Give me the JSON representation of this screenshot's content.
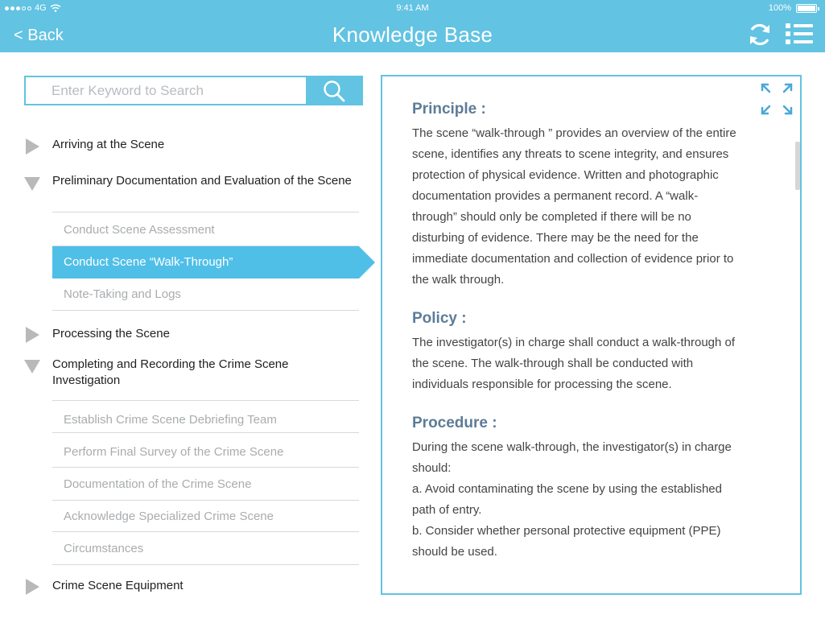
{
  "status": {
    "carrier": "4G",
    "time": "9:41 AM",
    "battery": "100%"
  },
  "header": {
    "back": "< Back",
    "title": "Knowledge Base",
    "accent": "#62c3e2"
  },
  "search": {
    "placeholder": "Enter Keyword to Search"
  },
  "nav": {
    "sections": [
      {
        "label": "Arriving at the Scene",
        "expanded": false
      },
      {
        "label": "Preliminary Documentation and Evaluation of the Scene",
        "expanded": true,
        "items": [
          "Conduct Scene Assessment",
          "Conduct Scene “Walk-Through”",
          "Note-Taking and Logs"
        ]
      },
      {
        "label": "Processing the Scene",
        "expanded": false
      },
      {
        "label": "Completing and Recording the Crime Scene Investigation",
        "expanded": true,
        "items": [
          "Establish Crime Scene Debriefing Team",
          "Perform Final Survey of the Crime Scene",
          "Documentation of the Crime Scene",
          "Acknowledge Specialized Crime Scene",
          "Circumstances"
        ]
      },
      {
        "label": "Crime Scene Equipment",
        "expanded": false
      }
    ],
    "active_item": "Conduct Scene “Walk-Through”"
  },
  "content": {
    "principle": {
      "heading": "Principle :",
      "lines": [
        "The scene “walk-through ” provides an overview of the entire",
        "scene, identifies any threats to scene integrity, and ensures",
        "protection of physical evidence. Written and photographic",
        "documentation provides a permanent record. A “walk-",
        "through” should only be completed if there will be no",
        "disturbing of evidence. There may be the need for the",
        "immediate documentation and collection of evidence prior to",
        "the walk through."
      ]
    },
    "policy": {
      "heading": "Policy :",
      "lines": [
        "The investigator(s) in charge shall conduct a walk-through of",
        "the scene. The walk-through shall be conducted with",
        "individuals responsible for processing the scene."
      ]
    },
    "procedure": {
      "heading": "Procedure :",
      "lines": [
        "During the scene walk-through, the investigator(s) in charge",
        "should:",
        "a. Avoid contaminating the scene by using the established",
        "path of entry.",
        "b. Consider whether personal protective equipment (PPE)",
        "should be used."
      ]
    }
  },
  "icons": {
    "refresh": "refresh-icon",
    "menu": "list-menu-icon",
    "search": "search-icon",
    "expand": "expand-icon",
    "collapsed": "triangle-right-icon",
    "expanded": "triangle-down-icon"
  }
}
